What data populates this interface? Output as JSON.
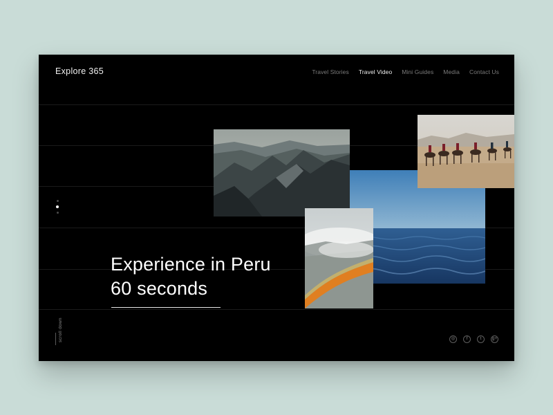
{
  "brand": "Explore 365",
  "nav": [
    {
      "label": "Travel Stories",
      "active": false
    },
    {
      "label": "Travel Video",
      "active": true
    },
    {
      "label": "Mini Guides",
      "active": false
    },
    {
      "label": "Media",
      "active": false
    },
    {
      "label": "Contact Us",
      "active": false
    }
  ],
  "slider": {
    "count": 3,
    "active_index": 1
  },
  "hero": {
    "line1": "Experience in Peru",
    "line2": "60 seconds"
  },
  "scroll_label": "scroll down",
  "social": [
    {
      "icon": "instagram-icon",
      "glyph": "◎"
    },
    {
      "icon": "facebook-icon",
      "glyph": "f"
    },
    {
      "icon": "twitter-icon",
      "glyph": "t"
    },
    {
      "icon": "google-plus-icon",
      "glyph": "g+"
    }
  ],
  "photos": [
    {
      "name": "mountains-photo"
    },
    {
      "name": "ocean-photo"
    },
    {
      "name": "camels-desert-photo"
    },
    {
      "name": "hot-spring-photo"
    }
  ],
  "colors": {
    "background": "#c9dcd7",
    "panel": "#000000",
    "text": "#ffffff",
    "muted": "#7c7c7c"
  }
}
